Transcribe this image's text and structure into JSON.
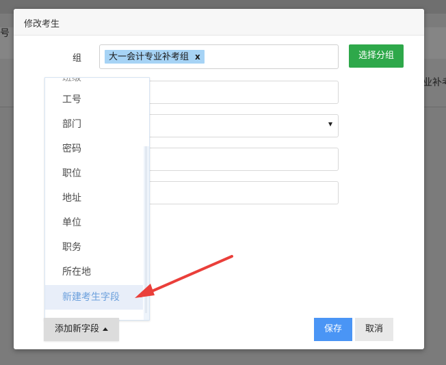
{
  "background": {
    "left_text": "号",
    "right_text": "业补考"
  },
  "modal": {
    "title": "修改考生",
    "group_label": "组",
    "group_tag": "大一会计专业补考组",
    "group_tag_remove": "x",
    "select_group_button": "选择分组"
  },
  "dropdown": {
    "partial_item": "班级",
    "items": [
      "工号",
      "部门",
      "密码",
      "职位",
      "地址",
      "单位",
      "职务",
      "所在地"
    ],
    "active_item": "新建考生字段"
  },
  "footer": {
    "add_field_button": "添加新字段",
    "save_button": "保存",
    "cancel_button": "取消"
  },
  "colors": {
    "save": "#4a95f5",
    "select_group": "#2ea84a",
    "tag": "#a6d3f5",
    "arrow": "#ea3f3a"
  }
}
